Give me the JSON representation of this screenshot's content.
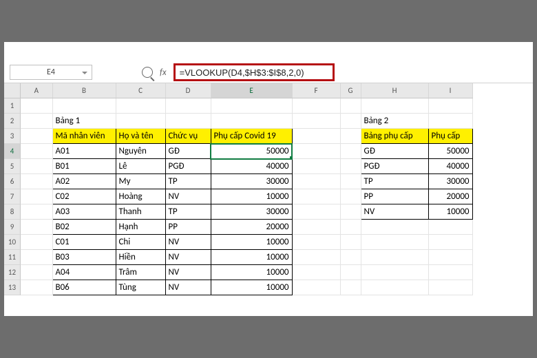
{
  "name_box": "E4",
  "formula": "=VLOOKUP(D4,$H$3:$I$8,2,0)",
  "columns": [
    "A",
    "B",
    "C",
    "D",
    "E",
    "F",
    "G",
    "H",
    "I"
  ],
  "selected_col": "E",
  "selected_row": 4,
  "row_count": 13,
  "table1": {
    "title": "Bảng 1",
    "headers": [
      "Mã nhân viên",
      "Họ và tên",
      "Chức vụ",
      "Phụ cấp Covid 19"
    ],
    "rows": [
      {
        "ma": "A01",
        "ten": "Nguyên",
        "cv": "GĐ",
        "pc": 50000
      },
      {
        "ma": "B01",
        "ten": "Lê",
        "cv": "PGĐ",
        "pc": 40000
      },
      {
        "ma": "A02",
        "ten": "My",
        "cv": "TP",
        "pc": 30000
      },
      {
        "ma": "C02",
        "ten": "Hoàng",
        "cv": "NV",
        "pc": 10000
      },
      {
        "ma": "A03",
        "ten": "Thanh",
        "cv": "TP",
        "pc": 30000
      },
      {
        "ma": "B02",
        "ten": "Hạnh",
        "cv": "PP",
        "pc": 20000
      },
      {
        "ma": "C01",
        "ten": "Chi",
        "cv": "NV",
        "pc": 10000
      },
      {
        "ma": "B03",
        "ten": "Hiền",
        "cv": "NV",
        "pc": 10000
      },
      {
        "ma": "A04",
        "ten": "Trâm",
        "cv": "NV",
        "pc": 10000
      },
      {
        "ma": "B06",
        "ten": "Tùng",
        "cv": "NV",
        "pc": 10000
      }
    ]
  },
  "table2": {
    "title": "Bảng 2",
    "headers": [
      "Bảng phụ cấp",
      "Phụ cấp"
    ],
    "rows": [
      {
        "k": "GĐ",
        "v": 50000
      },
      {
        "k": "PGĐ",
        "v": 40000
      },
      {
        "k": "TP",
        "v": 30000
      },
      {
        "k": "PP",
        "v": 20000
      },
      {
        "k": "NV",
        "v": 10000
      }
    ]
  }
}
